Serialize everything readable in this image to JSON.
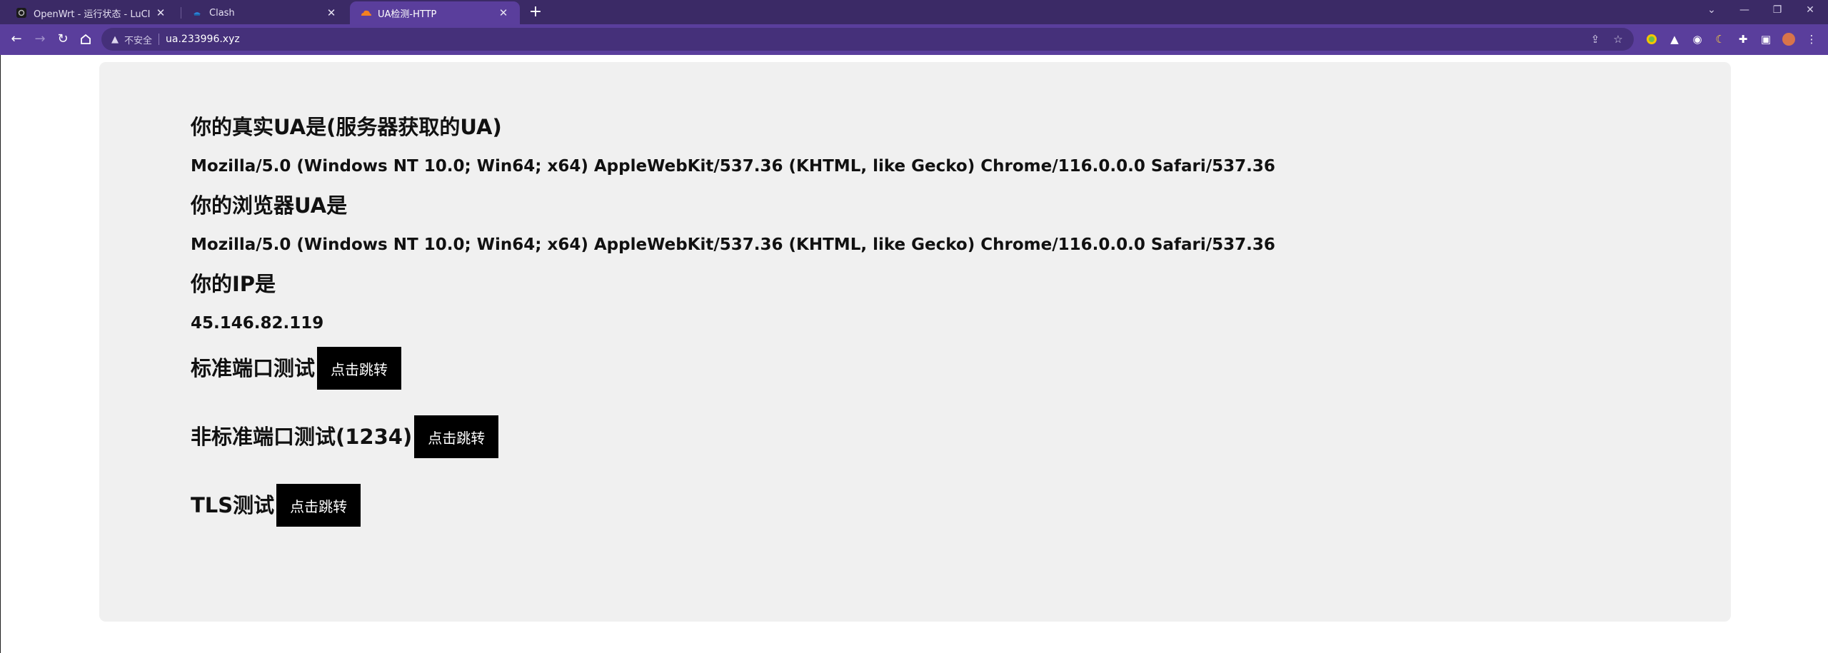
{
  "browser": {
    "tabs": [
      {
        "title": "OpenWrt - 运行状态 - LuCI",
        "favicon": "openwrt-icon",
        "active": false
      },
      {
        "title": "Clash",
        "favicon": "clash-icon",
        "active": false
      },
      {
        "title": "UA检测-HTTP",
        "favicon": "cloudflare-icon",
        "active": true
      }
    ],
    "new_tab_label": "+",
    "address_bar": {
      "security_label": "不安全",
      "url": "ua.233996.xyz"
    },
    "colors": {
      "tabstrip": "#3b2a66",
      "toolbar": "#5a3e9c",
      "omnibox": "#45307a"
    }
  },
  "page": {
    "real_ua": {
      "heading": "你的真实UA是(服务器获取的UA)",
      "value": "Mozilla/5.0 (Windows NT 10.0; Win64; x64) AppleWebKit/537.36 (KHTML, like Gecko) Chrome/116.0.0.0 Safari/537.36"
    },
    "browser_ua": {
      "heading": "你的浏览器UA是",
      "value": "Mozilla/5.0 (Windows NT 10.0; Win64; x64) AppleWebKit/537.36 (KHTML, like Gecko) Chrome/116.0.0.0 Safari/537.36"
    },
    "ip": {
      "heading": "你的IP是",
      "value": "45.146.82.119"
    },
    "tests": [
      {
        "label": "标准端口测试",
        "button": "点击跳转"
      },
      {
        "label": "非标准端口测试(1234)",
        "button": "点击跳转"
      },
      {
        "label": "TLS测试",
        "button": "点击跳转"
      }
    ],
    "colors": {
      "card_background": "#f0f0f0",
      "button_background": "#000000",
      "button_text": "#ffffff"
    }
  }
}
